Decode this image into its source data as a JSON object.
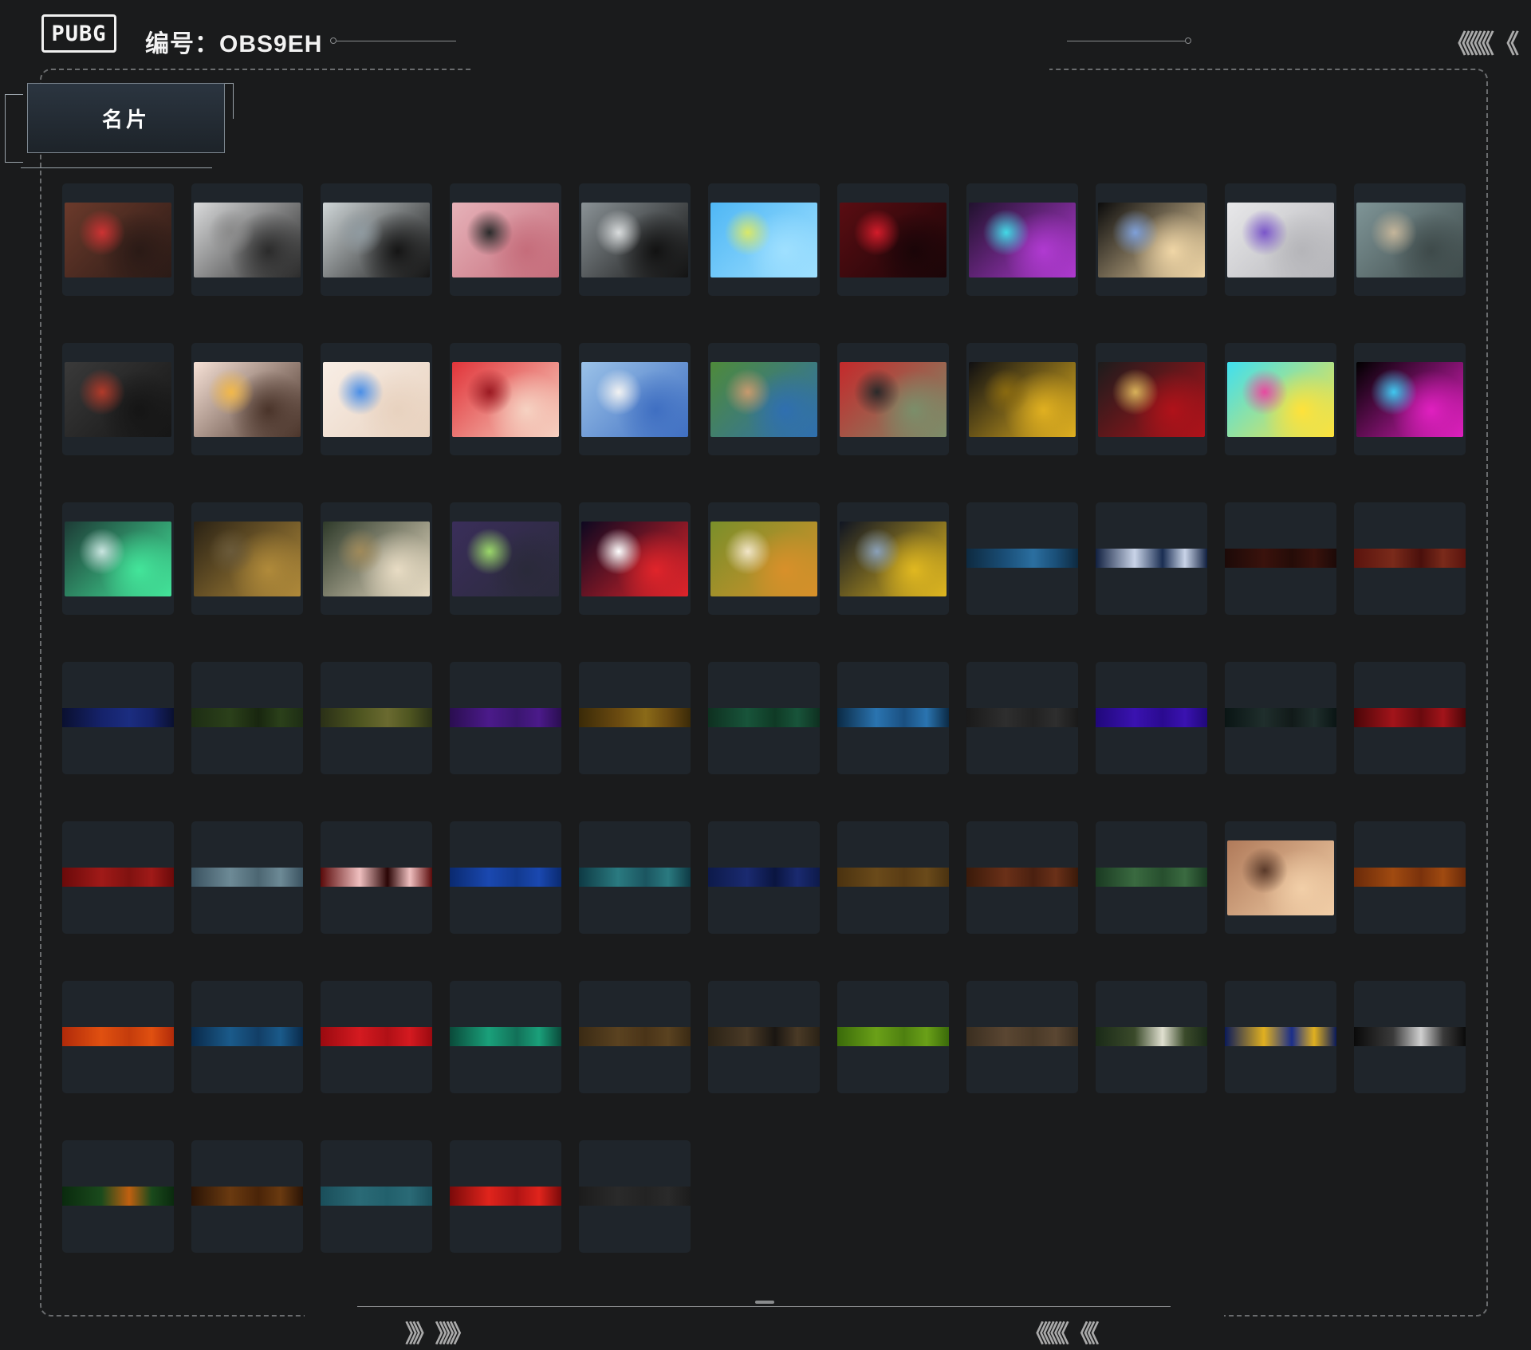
{
  "header": {
    "logo_text": "PUBG",
    "player_id": "编号：OBS9EH",
    "right_arrows": "《《《《 《"
  },
  "tab": {
    "label": "名片"
  },
  "footer": {
    "left_arrows": "》》 》》》",
    "right_arrows": "《《《《 《《"
  },
  "colors": {
    "background": "#1a1b1c",
    "card_bg": "#1f252b",
    "frame": "#6a6c6e"
  },
  "cards": [
    {
      "style": "thumb",
      "c1": "#6b3a2b",
      "c2": "#2a1a16",
      "c3": "#c33"
    },
    {
      "style": "thumb",
      "c1": "#d9dadb",
      "c2": "#2b2b2b",
      "c3": "#8a8a8a"
    },
    {
      "style": "thumb",
      "c1": "#cfd6d8",
      "c2": "#151515",
      "c3": "#8f9aa0"
    },
    {
      "style": "thumb",
      "c1": "#e6b2b9",
      "c2": "#c56d7b",
      "c3": "#2b2b2b"
    },
    {
      "style": "thumb",
      "c1": "#8a9296",
      "c2": "#121212",
      "c3": "#d9dcdd"
    },
    {
      "style": "thumb",
      "c1": "#4fb7f5",
      "c2": "#9fe0ff",
      "c3": "#d8e86a"
    },
    {
      "style": "thumb",
      "c1": "#5a0d12",
      "c2": "#1a0508",
      "c3": "#d21c2a"
    },
    {
      "style": "thumb",
      "c1": "#21122e",
      "c2": "#b03ad1",
      "c3": "#43d9e6"
    },
    {
      "style": "thumb",
      "c1": "#0c0c0c",
      "c2": "#f0d6a6",
      "c3": "#7fa0d8"
    },
    {
      "style": "thumb",
      "c1": "#e8e8ea",
      "c2": "#b5b5b9",
      "c3": "#7a56c9"
    },
    {
      "style": "thumb",
      "c1": "#7f9597",
      "c2": "#3e4a4a",
      "c3": "#c4b59a"
    },
    {
      "style": "thumb",
      "c1": "#3a3a3a",
      "c2": "#151515",
      "c3": "#b13a2a"
    },
    {
      "style": "thumb",
      "c1": "#f6e1d6",
      "c2": "#4a342a",
      "c3": "#f2b84a"
    },
    {
      "style": "thumb",
      "c1": "#f8eee6",
      "c2": "#e8d2bf",
      "c3": "#4a8ee6"
    },
    {
      "style": "thumb",
      "c1": "#e1343a",
      "c2": "#f6d2c2",
      "c3": "#9b1a22"
    },
    {
      "style": "thumb",
      "c1": "#9bc2e8",
      "c2": "#3f6fc2",
      "c3": "#f2f2f2"
    },
    {
      "style": "thumb",
      "c1": "#4e8a3a",
      "c2": "#2f6fb0",
      "c3": "#c79a6e"
    },
    {
      "style": "thumb",
      "c1": "#c5292b",
      "c2": "#7b8e6a",
      "c3": "#2a2a2a"
    },
    {
      "style": "thumb",
      "c1": "#0f0f12",
      "c2": "#e0b020",
      "c3": "#8a6a10"
    },
    {
      "style": "thumb",
      "c1": "#1c1c1c",
      "c2": "#b0121a",
      "c3": "#d9b25a"
    },
    {
      "style": "thumb",
      "c1": "#3fe0f0",
      "c2": "#ffe23a",
      "c3": "#e84aa0"
    },
    {
      "style": "thumb",
      "c1": "#000000",
      "c2": "#e020c0",
      "c3": "#40c8f0"
    },
    {
      "style": "thumb",
      "c1": "#1d3b36",
      "c2": "#43e59a",
      "c3": "#c9e5e0"
    },
    {
      "style": "thumb",
      "c1": "#2a2215",
      "c2": "#b08a3a",
      "c3": "#6a5a3a"
    },
    {
      "style": "thumb",
      "c1": "#2e3a2a",
      "c2": "#e8dcc4",
      "c3": "#a08a5a"
    },
    {
      "style": "thumb",
      "c1": "#3a2e5a",
      "c2": "#2a2a3a",
      "c3": "#9bd86a"
    },
    {
      "style": "thumb",
      "c1": "#0d0820",
      "c2": "#e0242a",
      "c3": "#ffffff"
    },
    {
      "style": "thumb",
      "c1": "#7a8f2a",
      "c2": "#d8902a",
      "c3": "#f2e6c8"
    },
    {
      "style": "thumb",
      "c1": "#101522",
      "c2": "#e0b820",
      "c3": "#8aa0b8"
    },
    {
      "style": "band",
      "c1": "#0e2a40",
      "c2": "#1a4f78",
      "c3": "#2b6fa0"
    },
    {
      "style": "band",
      "c1": "#112040",
      "c2": "#c9d4e8",
      "c3": "#1a2e52"
    },
    {
      "style": "band",
      "c1": "#1c0a08",
      "c2": "#3a120c",
      "c3": "#250c08"
    },
    {
      "style": "band",
      "c1": "#5a140e",
      "c2": "#7a2a1a",
      "c3": "#4a100c"
    },
    {
      "style": "band",
      "c1": "#0a1030",
      "c2": "#15226a",
      "c3": "#1b2d80"
    },
    {
      "style": "band",
      "c1": "#1d2d14",
      "c2": "#2b401a",
      "c3": "#18260f"
    },
    {
      "style": "band",
      "c1": "#2a3017",
      "c2": "#4e5520",
      "c3": "#6a6a30"
    },
    {
      "style": "band",
      "c1": "#2a0e50",
      "c2": "#4b1a8a",
      "c3": "#3a1670"
    },
    {
      "style": "band",
      "c1": "#3a2a08",
      "c2": "#6a4a10",
      "c3": "#8a6a18"
    },
    {
      "style": "band",
      "c1": "#0e3020",
      "c2": "#18543a",
      "c3": "#0f3a25"
    },
    {
      "style": "band",
      "c1": "#0b2a45",
      "c2": "#2a74b0",
      "c3": "#1a4f80"
    },
    {
      "style": "band",
      "c1": "#1a1a1a",
      "c2": "#2e2e2e",
      "c3": "#222222"
    },
    {
      "style": "band",
      "c1": "#20087a",
      "c2": "#3a12b0",
      "c3": "#2a0a90"
    },
    {
      "style": "band",
      "c1": "#0a1514",
      "c2": "#1f2e2c",
      "c3": "#111a19"
    },
    {
      "style": "band",
      "c1": "#4a0608",
      "c2": "#a2141a",
      "c3": "#6a0a0e"
    },
    {
      "style": "band",
      "c1": "#6a0a0a",
      "c2": "#a01a18",
      "c3": "#801210"
    },
    {
      "style": "band",
      "c1": "#3a5260",
      "c2": "#6d8a96",
      "c3": "#4c6672"
    },
    {
      "style": "band",
      "c1": "#5a0a0a",
      "c2": "#f0c0c0",
      "c3": "#2a0505"
    },
    {
      "style": "band",
      "c1": "#0a2a70",
      "c2": "#1a48b0",
      "c3": "#123a90"
    },
    {
      "style": "band",
      "c1": "#0e3a44",
      "c2": "#2a7a80",
      "c3": "#1b5560"
    },
    {
      "style": "band",
      "c1": "#0d1a4a",
      "c2": "#1a2a70",
      "c3": "#0a1540"
    },
    {
      "style": "band",
      "c1": "#4a3210",
      "c2": "#6a4a1a",
      "c3": "#5a3c14"
    },
    {
      "style": "band",
      "c1": "#3a1a0a",
      "c2": "#6a3018",
      "c3": "#4a2010"
    },
    {
      "style": "band",
      "c1": "#1a3a22",
      "c2": "#3a6a40",
      "c3": "#274f2e"
    },
    {
      "style": "thumb",
      "c1": "#b07a5a",
      "c2": "#f2cfa8",
      "c3": "#5a3a2a"
    },
    {
      "style": "band",
      "c1": "#6a2a0a",
      "c2": "#a04a10",
      "c3": "#7a320c"
    },
    {
      "style": "band",
      "c1": "#b02a0a",
      "c2": "#e05010",
      "c3": "#c43c0c"
    },
    {
      "style": "band",
      "c1": "#0a2a4a",
      "c2": "#1a5a8a",
      "c3": "#123e66"
    },
    {
      "style": "band",
      "c1": "#9a0a10",
      "c2": "#d41a20",
      "c3": "#b01016"
    },
    {
      "style": "band",
      "c1": "#0a4a3a",
      "c2": "#1aa07a",
      "c3": "#127058"
    },
    {
      "style": "band",
      "c1": "#3a2a14",
      "c2": "#5a4220",
      "c3": "#4a3418"
    },
    {
      "style": "band",
      "c1": "#2a2216",
      "c2": "#4a3a26",
      "c3": "#1a1612"
    },
    {
      "style": "band",
      "c1": "#3a6a0a",
      "c2": "#6aa018",
      "c3": "#4e8010"
    },
    {
      "style": "band",
      "c1": "#3a2e20",
      "c2": "#5a4632",
      "c3": "#4a3a28"
    },
    {
      "style": "band",
      "c1": "#1a2a18",
      "c2": "#3a4a2a",
      "c3": "#e0e0d0"
    },
    {
      "style": "band",
      "c1": "#0a1a5a",
      "c2": "#e0b020",
      "c3": "#1a2e8a"
    },
    {
      "style": "band",
      "c1": "#0a0a0a",
      "c2": "#3a3a3a",
      "c3": "#d0d0d0"
    },
    {
      "style": "band",
      "c1": "#0a2a0e",
      "c2": "#1a4a1c",
      "c3": "#c06010"
    },
    {
      "style": "band",
      "c1": "#2a1406",
      "c2": "#6a3a10",
      "c3": "#4a2408"
    },
    {
      "style": "band",
      "c1": "#1a4e5a",
      "c2": "#2a6a76",
      "c3": "#22606c"
    },
    {
      "style": "band",
      "c1": "#7a0a0a",
      "c2": "#e0241c",
      "c3": "#b01414"
    },
    {
      "style": "band",
      "c1": "#1c1c1c",
      "c2": "#2a2a2a",
      "c3": "#232323"
    }
  ]
}
